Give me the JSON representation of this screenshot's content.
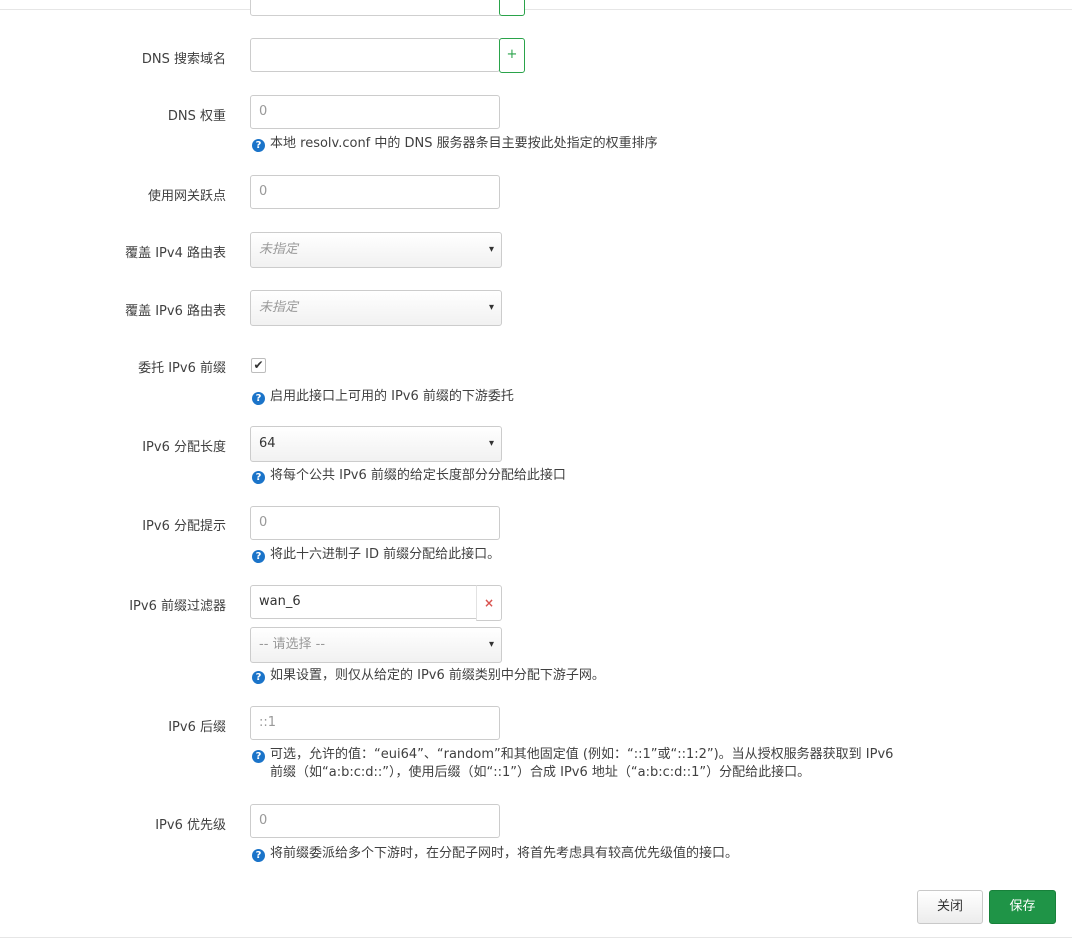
{
  "fields": {
    "dns_search": {
      "label": "DNS 搜索域名",
      "add_label": "+"
    },
    "dns_weight": {
      "label": "DNS 权重",
      "placeholder": "0",
      "help": "本地 resolv.conf 中的 DNS 服务器条目主要按此处指定的权重排序"
    },
    "gateway_metric": {
      "label": "使用网关跃点",
      "placeholder": "0"
    },
    "ipv4_table": {
      "label": "覆盖 IPv4 路由表",
      "value": "未指定"
    },
    "ipv6_table": {
      "label": "覆盖 IPv6 路由表",
      "value": "未指定"
    },
    "delegate": {
      "label": "委托 IPv6 前缀",
      "checked": true,
      "help": "启用此接口上可用的 IPv6 前缀的下游委托"
    },
    "assign_length": {
      "label": "IPv6 分配长度",
      "value": "64",
      "help": "将每个公共 IPv6 前缀的给定长度部分分配给此接口"
    },
    "assign_hint": {
      "label": "IPv6 分配提示",
      "placeholder": "0",
      "help": "将此十六进制子 ID 前缀分配给此接口。"
    },
    "prefix_filter": {
      "label": "IPv6 前缀过滤器",
      "value": "wan_6",
      "remove_label": "×",
      "select_placeholder": "-- 请选择 --",
      "help": "如果设置，则仅从给定的 IPv6 前缀类别中分配下游子网。"
    },
    "suffix": {
      "label": "IPv6 后缀",
      "placeholder": "::1",
      "help_line1": "可选，允许的值：“eui64”、“random”和其他固定值 (例如：“::1”或“::1:2”)。当从授权服务器获取到 IPv6",
      "help_line2": "前缀（如“a:b:c:d::”），使用后缀（如“::1”）合成 IPv6 地址（“a:b:c:d::1”）分配给此接口。"
    },
    "priority": {
      "label": "IPv6 优先级",
      "placeholder": "0",
      "help": "将前缀委派给多个下游时，在分配子网时，将首先考虑具有较高优先级值的接口。"
    }
  },
  "icons": {
    "help": "?",
    "caret": "▾",
    "check": "✔"
  },
  "buttons": {
    "close": "关闭",
    "save": "保存"
  },
  "colors": {
    "accent": "#1f9447",
    "help_icon": "#1b74c9",
    "remove": "#d9534f"
  }
}
